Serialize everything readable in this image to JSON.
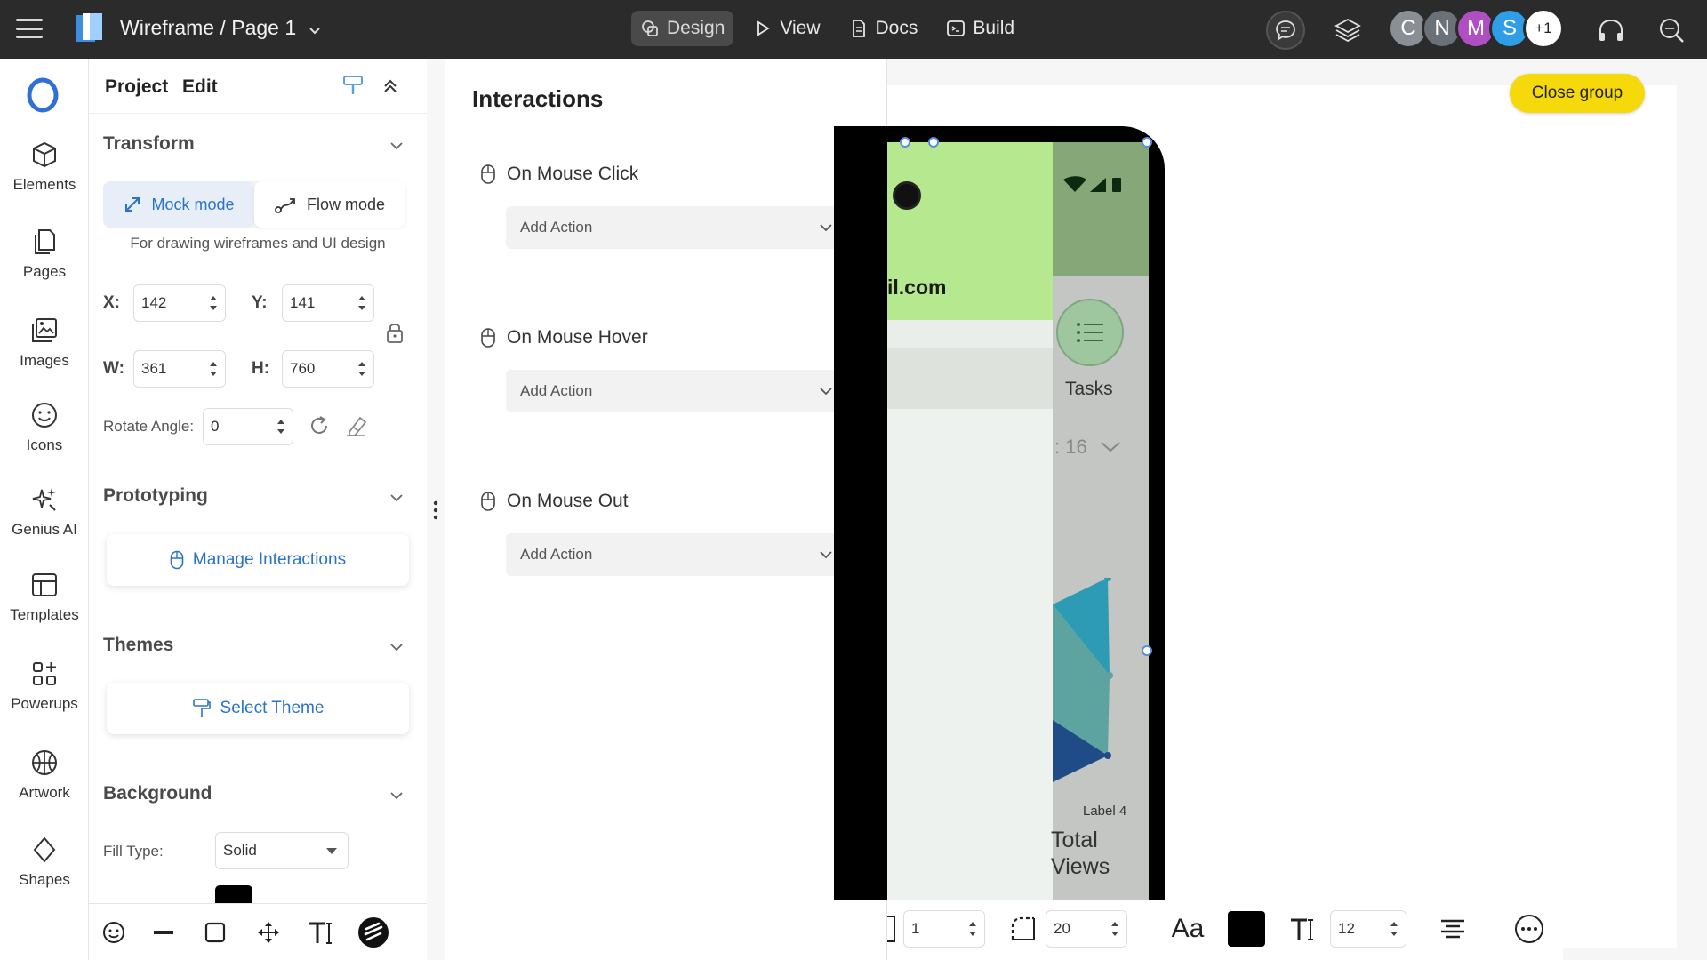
{
  "topbar": {
    "doc_title": "Wireframe / Page 1",
    "modes": [
      {
        "label": "Design",
        "icon": "design-icon",
        "active": true
      },
      {
        "label": "View",
        "icon": "play-icon",
        "active": false
      },
      {
        "label": "Docs",
        "icon": "document-icon",
        "active": false
      },
      {
        "label": "Build",
        "icon": "code-icon",
        "active": false
      }
    ],
    "avatars": [
      {
        "letter": "C",
        "color": "#8a8f96"
      },
      {
        "letter": "N",
        "color": "#6b7179"
      },
      {
        "letter": "M",
        "color": "#b04fc4"
      },
      {
        "letter": "S",
        "color": "#2e9ee8"
      },
      {
        "letter": "+1",
        "color": "#ffffff"
      }
    ]
  },
  "rail": {
    "items": [
      {
        "label": "Elements",
        "icon": "cube-icon"
      },
      {
        "label": "Pages",
        "icon": "pages-icon"
      },
      {
        "label": "Images",
        "icon": "images-icon"
      },
      {
        "label": "Icons",
        "icon": "smiley-icon"
      },
      {
        "label": "Genius AI",
        "icon": "sparkle-icon"
      },
      {
        "label": "Templates",
        "icon": "templates-icon"
      },
      {
        "label": "Powerups",
        "icon": "powerups-icon"
      },
      {
        "label": "Artwork",
        "icon": "basketball-icon"
      },
      {
        "label": "Shapes",
        "icon": "diamond-icon"
      }
    ]
  },
  "panel": {
    "tabs": [
      "Project",
      "Edit"
    ],
    "transform": {
      "title": "Transform",
      "mock_mode": "Mock mode",
      "flow_mode": "Flow mode",
      "hint": "For drawing wireframes and UI design",
      "x_label": "X:",
      "x_value": "142",
      "y_label": "Y:",
      "y_value": "141",
      "w_label": "W:",
      "w_value": "361",
      "h_label": "H:",
      "h_value": "760",
      "rotate_label": "Rotate Angle:",
      "rotate_value": "0"
    },
    "prototyping": {
      "title": "Prototyping",
      "button": "Manage Interactions"
    },
    "themes": {
      "title": "Themes",
      "button": "Select Theme"
    },
    "background": {
      "title": "Background",
      "fill_label": "Fill Type:",
      "fill_value": "Solid",
      "fill_color": "#000000"
    }
  },
  "interactions": {
    "title": "Interactions",
    "events": [
      {
        "label": "On Mouse Click",
        "action": "Add Action"
      },
      {
        "label": "On Mouse Hover",
        "action": "Add Action"
      },
      {
        "label": "On Mouse Out",
        "action": "Add Action"
      }
    ]
  },
  "canvas": {
    "close_group": "Close group",
    "phone": {
      "email_fragment": "il.com",
      "tasks_label": "Tasks",
      "count_fragment": ": 16",
      "chart_label": "Label 4",
      "total_line1": "Total",
      "total_line2": "Views"
    },
    "toolbar": {
      "stroke_value": "1",
      "radius_value": "20",
      "font_label": "Aa",
      "text_color": "#000000",
      "font_size": "12"
    }
  },
  "colors": {
    "accent": "#2b73c9",
    "close_group": "#f5d90a",
    "phone_green": "#b6e88f"
  }
}
